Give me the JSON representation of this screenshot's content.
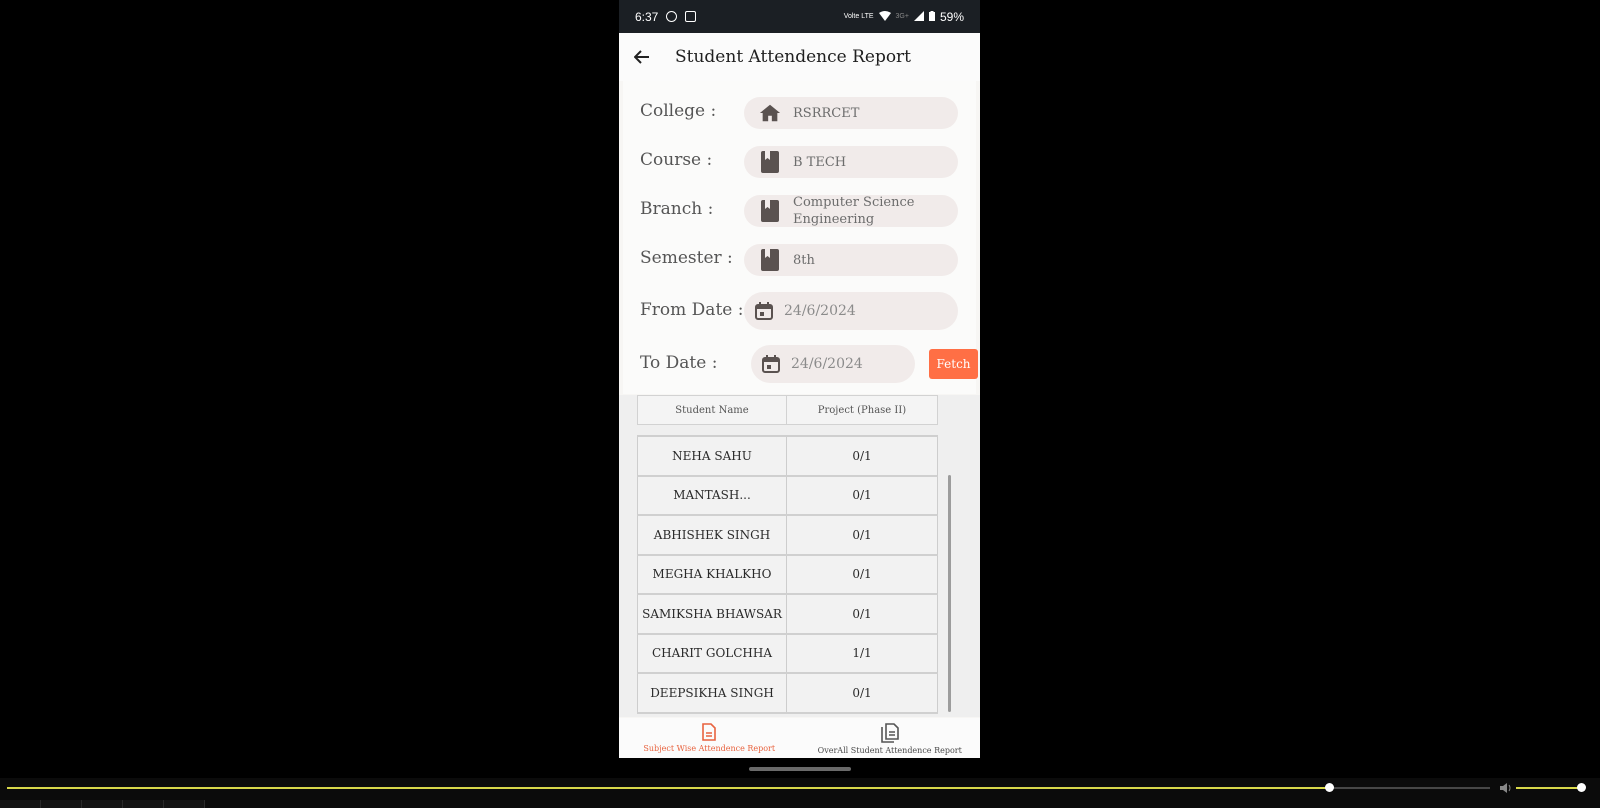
{
  "status_bar": {
    "time": "6:37",
    "network": "Volte LTE",
    "signal_type": "3G+",
    "battery": "59%"
  },
  "app_bar": {
    "title": "Student Attendence Report"
  },
  "form": {
    "college": {
      "label": "College :",
      "value": "RSRRCET",
      "icon": "home-icon"
    },
    "course": {
      "label": "Course :",
      "value": "B TECH",
      "icon": "book-icon"
    },
    "branch": {
      "label": "Branch :",
      "value": "Computer Science Engineering",
      "icon": "book-icon"
    },
    "semester": {
      "label": "Semester :",
      "value": "8th",
      "icon": "book-icon"
    },
    "from_date": {
      "label": "From Date :",
      "value": "24/6/2024",
      "icon": "calendar-icon"
    },
    "to_date": {
      "label": "To Date :",
      "value": "24/6/2024",
      "icon": "calendar-icon"
    },
    "fetch_label": "Fetch"
  },
  "table": {
    "headers": [
      "Student Name",
      "Project (Phase  II)"
    ],
    "rows": [
      [
        "NEHA SAHU",
        "0/1"
      ],
      [
        "MANTASH...",
        "0/1"
      ],
      [
        "ABHISHEK SINGH",
        "0/1"
      ],
      [
        "MEGHA KHALKHO",
        "0/1"
      ],
      [
        "SAMIKSHA BHAWSAR",
        "0/1"
      ],
      [
        "CHARIT GOLCHHA",
        "1/1"
      ],
      [
        "DEEPSIKHA SINGH",
        "0/1"
      ]
    ]
  },
  "bottom_nav": {
    "items": [
      {
        "label": "Subject Wise Attendence Report",
        "icon": "document-icon",
        "active": true
      },
      {
        "label": "OverAll Student Attendence Report",
        "icon": "documents-icon",
        "active": false
      }
    ]
  },
  "colors": {
    "accent": "#ff6f45",
    "active_tab": "#e8633f",
    "progress": "#d8d84a"
  },
  "player": {
    "progress_fraction": 0.885,
    "volume_fraction": 0.95
  }
}
